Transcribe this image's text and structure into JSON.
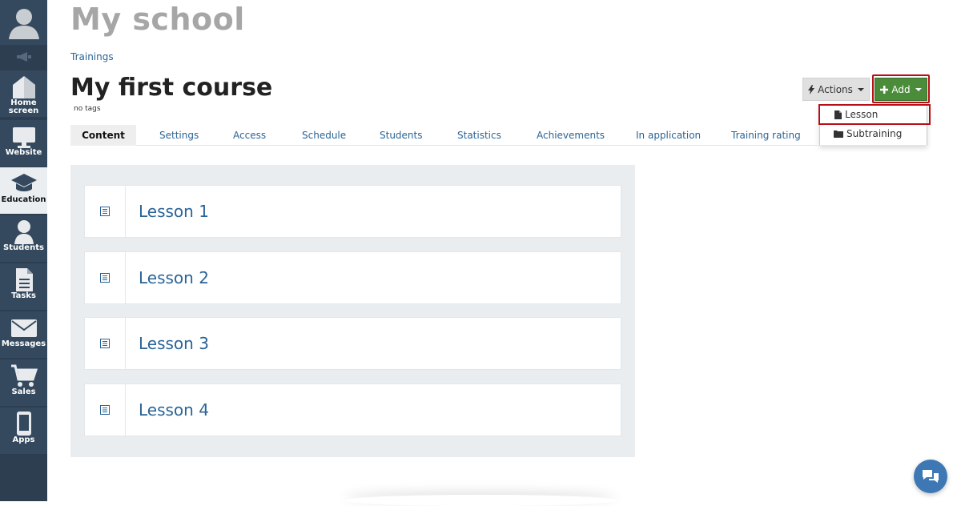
{
  "sidebar": {
    "items": [
      {
        "label_line1": "Home",
        "label_line2": "screen",
        "icon": "home-icon"
      },
      {
        "label_line1": "Website",
        "icon": "monitor-icon"
      },
      {
        "label_line1": "Education",
        "icon": "graduation-cap-icon"
      },
      {
        "label_line1": "Students",
        "icon": "user-icon"
      },
      {
        "label_line1": "Tasks",
        "icon": "document-icon"
      },
      {
        "label_line1": "Messages",
        "icon": "envelope-icon"
      },
      {
        "label_line1": "Sales",
        "icon": "cart-icon"
      },
      {
        "label_line1": "Apps",
        "icon": "phone-icon"
      }
    ],
    "active_item": "Education"
  },
  "header": {
    "school_title": "My school",
    "breadcrumb": "Trainings",
    "course_title": "My first course",
    "tags": "no tags"
  },
  "toolbar": {
    "actions_label": "Actions",
    "add_label": "Add"
  },
  "add_menu": {
    "items": [
      {
        "label": "Lesson",
        "icon": "file-icon"
      },
      {
        "label": "Subtraining",
        "icon": "folder-icon"
      }
    ]
  },
  "tabs": [
    {
      "label": "Content"
    },
    {
      "label": "Settings"
    },
    {
      "label": "Access"
    },
    {
      "label": "Schedule"
    },
    {
      "label": "Students"
    },
    {
      "label": "Statistics"
    },
    {
      "label": "Achievements"
    },
    {
      "label": "In application"
    },
    {
      "label": "Training rating"
    }
  ],
  "active_tab": "Content",
  "lessons": [
    {
      "title": "Lesson 1"
    },
    {
      "title": "Lesson 2"
    },
    {
      "title": "Lesson 3"
    },
    {
      "title": "Lesson 4"
    }
  ],
  "colors": {
    "sidebar": "#2d3e50",
    "link": "#2a6496",
    "add_button": "#4a8c3a",
    "highlight": "#b80f16",
    "chat": "#3d78b4"
  }
}
